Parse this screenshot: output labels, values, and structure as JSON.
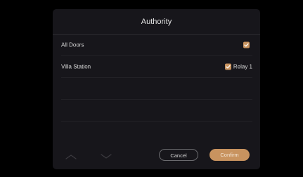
{
  "dialog": {
    "title": "Authority",
    "rows": [
      {
        "label": "All Doors",
        "checked": true,
        "relay": ""
      },
      {
        "label": "Villa Station",
        "checked": true,
        "relay": "Relay 1"
      }
    ],
    "cancel_label": "Cancel",
    "confirm_label": "Confirm"
  },
  "colors": {
    "accent": "#c8935f",
    "background": "#17161b"
  }
}
